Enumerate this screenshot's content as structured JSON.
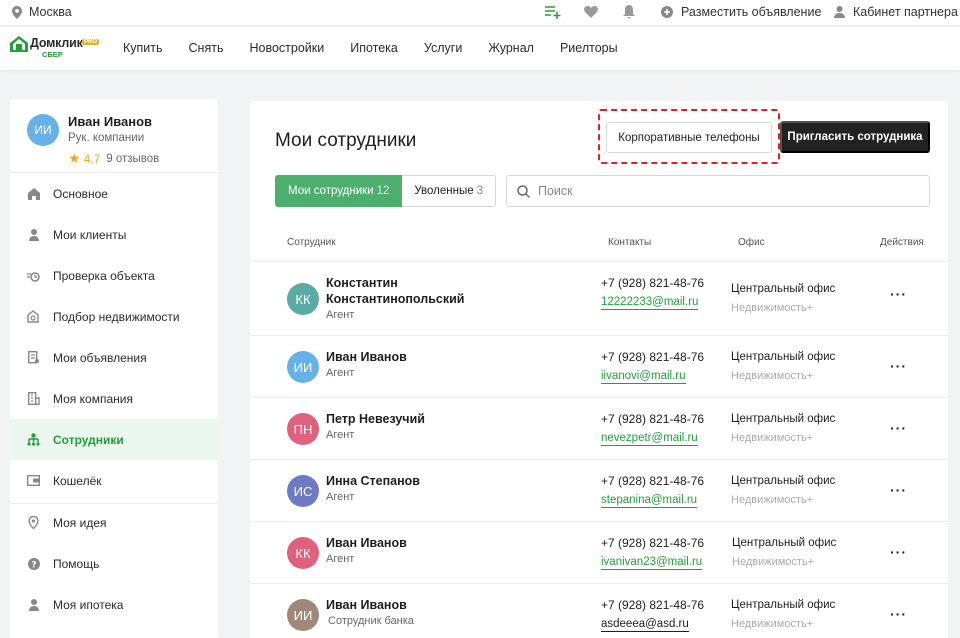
{
  "topbar": {
    "city": "Москва",
    "post_ad": "Разместить объявление",
    "partner_cabinet": "Кабинет партнера"
  },
  "logo": {
    "name": "Домклик",
    "badge": "PRO",
    "sub": "СБЕР"
  },
  "nav": [
    "Купить",
    "Снять",
    "Новостройки",
    "Ипотека",
    "Услуги",
    "Журнал",
    "Риелторы"
  ],
  "profile": {
    "initials": "ИИ",
    "name": "Иван Иванов",
    "role": "Рук. компании",
    "rating": "4,7",
    "reviews": "9 отзывов"
  },
  "menu": [
    {
      "label": "Основное",
      "icon": "home-icon"
    },
    {
      "label": "Мои клиенты",
      "icon": "person-icon"
    },
    {
      "label": "Проверка объекта",
      "icon": "check-object-icon"
    },
    {
      "label": "Подбор недвижимости",
      "icon": "house-search-icon"
    },
    {
      "label": "Мои объявления",
      "icon": "ads-icon"
    },
    {
      "label": "Моя компания",
      "icon": "company-icon"
    },
    {
      "label": "Сотрудники",
      "icon": "employees-icon"
    },
    {
      "label": "Кошелёк",
      "icon": "wallet-icon"
    },
    {
      "label": "Моя идея",
      "icon": "idea-icon"
    },
    {
      "label": "Помощь",
      "icon": "help-icon"
    },
    {
      "label": "Моя ипотека",
      "icon": "person-icon"
    }
  ],
  "main": {
    "title": "Мои сотрудники",
    "corp_phones_button": "Корпоративные телефоны",
    "invite_button": "Пригласить сотрудника",
    "tabs": [
      {
        "label": "Мои сотрудники",
        "count": "12"
      },
      {
        "label": "Уволенные",
        "count": "3"
      }
    ],
    "search_placeholder": "Поиск",
    "columns": [
      "Сотрудник",
      "Контакты",
      "Офис",
      "Действия"
    ],
    "office_name": "Центральный офис",
    "office_sub": "Недвижимость+",
    "actions_glyph": "···",
    "employees": [
      {
        "initials": "КК",
        "name": "Константин Константинопольский",
        "role": "Агент",
        "phone": "+7 (928) 821-48-76",
        "email": "12222233@mail.ru",
        "color": "#5aaba3"
      },
      {
        "initials": "ИИ",
        "name": "Иван Иванов",
        "role": "Агент",
        "phone": "+7 (928) 821-48-76",
        "email": "iivanovi@mail.ru",
        "color": "#66b2e8"
      },
      {
        "initials": "ПН",
        "name": "Петр Невезучий",
        "role": "Агент",
        "phone": "+7 (928) 821-48-76",
        "email": "nevezpetr@mail.ru",
        "color": "#e0607e"
      },
      {
        "initials": "ИС",
        "name": "Инна Степанов",
        "role": "Агент",
        "phone": "+7 (928) 821-48-76",
        "email": "stepanina@mail.ru",
        "color": "#6c7cc4"
      },
      {
        "initials": "КК",
        "name": "Иван Иванов",
        "role": "Агент",
        "phone": "+7 (928) 821-48-76",
        "email": "ivanivan23@mail.ru",
        "color": "#e0607e"
      },
      {
        "initials": "ИИ",
        "name": "Иван Иванов",
        "role": "Сотрудник банка",
        "phone": "+7 (928) 821-48-76",
        "email": "asdeeea@asd.ru",
        "color": "#a08878"
      }
    ]
  }
}
